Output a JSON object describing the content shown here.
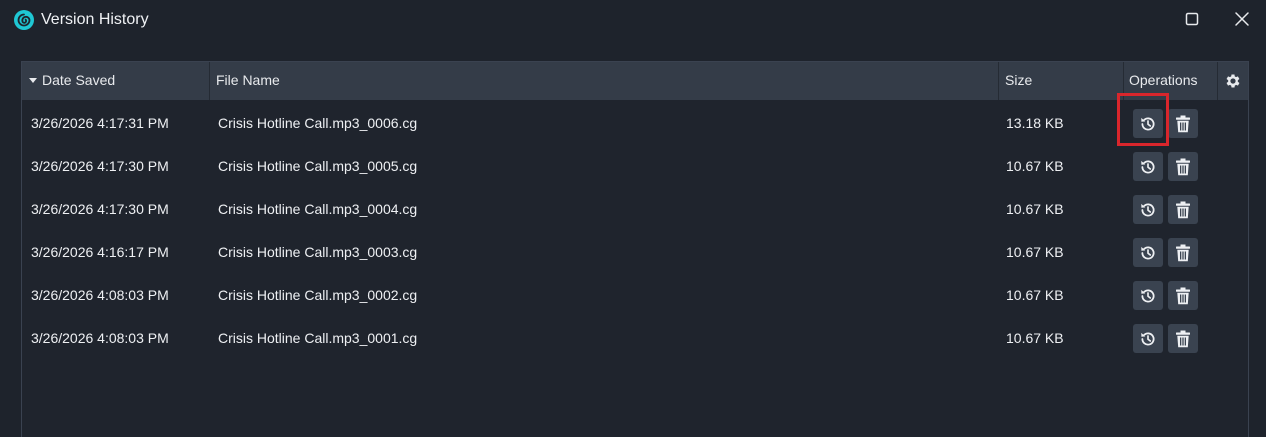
{
  "window": {
    "title": "Version History",
    "app_icon": "spiral-logo-icon",
    "controls": [
      "maximize-icon",
      "close-icon"
    ]
  },
  "table": {
    "columns": {
      "date_saved": "Date Saved",
      "file_name": "File Name",
      "size": "Size",
      "operations": "Operations"
    },
    "sort": "descending",
    "rows": [
      {
        "date": "3/26/2026 4:17:31 PM",
        "name": "Crisis Hotline Call.mp3_0006.cg",
        "size": "13.18 KB"
      },
      {
        "date": "3/26/2026 4:17:30 PM",
        "name": "Crisis Hotline Call.mp3_0005.cg",
        "size": "10.67 KB"
      },
      {
        "date": "3/26/2026 4:17:30 PM",
        "name": "Crisis Hotline Call.mp3_0004.cg",
        "size": "10.67 KB"
      },
      {
        "date": "3/26/2026 4:16:17 PM",
        "name": "Crisis Hotline Call.mp3_0003.cg",
        "size": "10.67 KB"
      },
      {
        "date": "3/26/2026 4:08:03 PM",
        "name": "Crisis Hotline Call.mp3_0002.cg",
        "size": "10.67 KB"
      },
      {
        "date": "3/26/2026 4:08:03 PM",
        "name": "Crisis Hotline Call.mp3_0001.cg",
        "size": "10.67 KB"
      }
    ],
    "row_operations": [
      "restore-history-icon",
      "trash-icon"
    ]
  },
  "colors": {
    "background": "#1e232c",
    "header": "#343c48",
    "button": "#3a4350",
    "accent": "#1fc7d4",
    "highlight": "#d9262c"
  }
}
